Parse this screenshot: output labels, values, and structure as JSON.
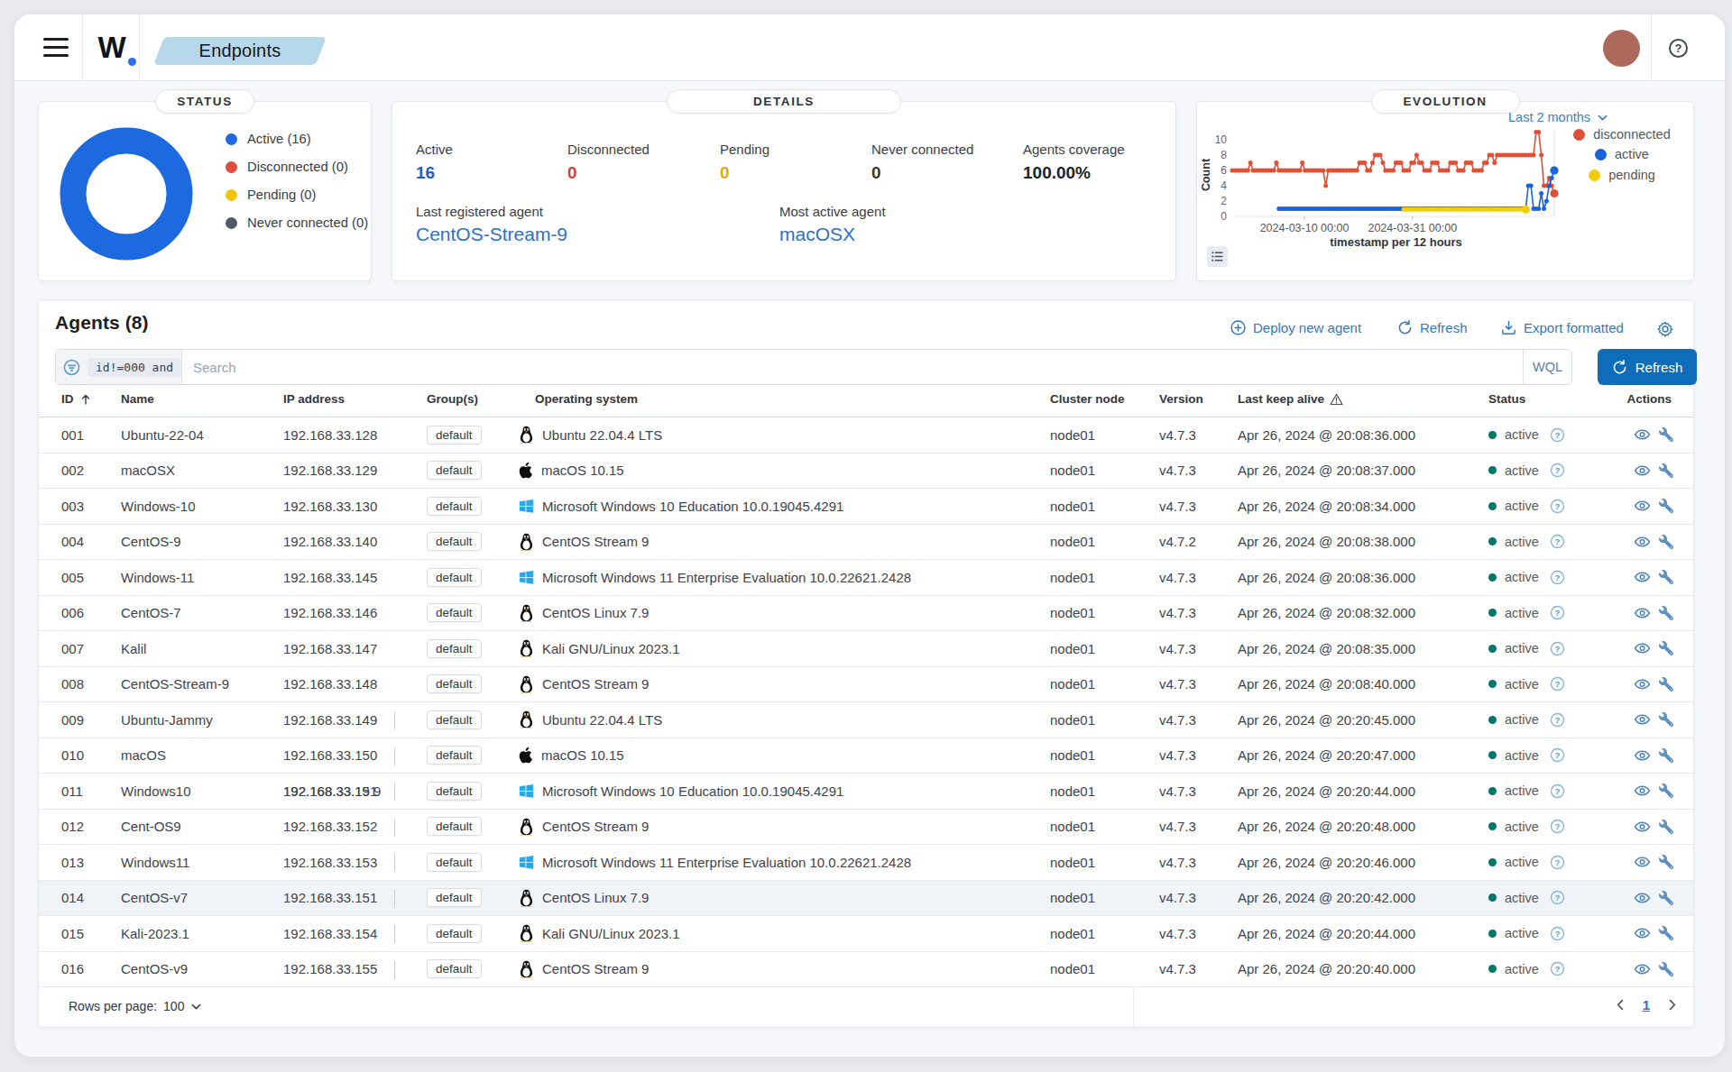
{
  "topbar": {
    "logo_text": "W",
    "logo_dot": ".",
    "breadcrumb": "Endpoints"
  },
  "panels": {
    "status": {
      "title": "STATUS"
    },
    "details": {
      "title": "DETAILS",
      "stats": [
        {
          "label": "Active",
          "value": "16",
          "color": "#1f5ec9"
        },
        {
          "label": "Disconnected",
          "value": "0",
          "color": "#c6493a"
        },
        {
          "label": "Pending",
          "value": "0",
          "color": "#dfa821"
        },
        {
          "label": "Never connected",
          "value": "0",
          "color": "#363940"
        },
        {
          "label": "Agents coverage",
          "value": "100.00%",
          "color": "#20232a"
        }
      ],
      "info": [
        {
          "label": "Last registered agent",
          "value": "CentOS-Stream-9"
        },
        {
          "label": "Most active agent",
          "value": "macOSX"
        }
      ]
    },
    "evolution": {
      "title": "EVOLUTION",
      "range_label": "Last 2 months"
    }
  },
  "chart_data": [
    {
      "id": "agents-status-donut",
      "type": "pie",
      "title": "STATUS",
      "labels": [
        "Active",
        "Disconnected",
        "Pending",
        "Never connected"
      ],
      "values": [
        16,
        0,
        0,
        0
      ],
      "colors": [
        "#1c69e0",
        "#dc4d3b",
        "#f2c40f",
        "#55595f"
      ],
      "donut": true
    },
    {
      "id": "agents-evolution",
      "type": "line",
      "title": "EVOLUTION",
      "xlabel": "timestamp per 12 hours",
      "ylabel": "Count",
      "range_label": "Last 2 months",
      "x_span_days": 62,
      "x_ticks": [
        {
          "label": "2024-03-10 00:00",
          "day": 13.9
        },
        {
          "label": "2024-03-31 00:00",
          "day": 34.7
        }
      ],
      "y_ticks": [
        0,
        2,
        4,
        6,
        8,
        10
      ],
      "ylim": [
        0,
        11.5
      ],
      "legend_position": "right",
      "series": [
        {
          "name": "disconnected",
          "color": "#e05038",
          "points": [
            [
              0,
              6
            ],
            [
              3,
              6
            ],
            [
              3.5,
              7
            ],
            [
              4,
              6
            ],
            [
              8,
              6
            ],
            [
              8.5,
              7
            ],
            [
              9,
              6
            ],
            [
              13,
              6
            ],
            [
              13.5,
              7
            ],
            [
              14,
              6
            ],
            [
              17.5,
              6
            ],
            [
              18,
              4
            ],
            [
              18.5,
              6
            ],
            [
              24,
              6
            ],
            [
              24.5,
              7
            ],
            [
              25.5,
              7
            ],
            [
              26,
              6
            ],
            [
              27,
              7
            ],
            [
              27.5,
              8
            ],
            [
              28.5,
              8
            ],
            [
              29,
              7
            ],
            [
              29.5,
              6
            ],
            [
              31,
              6
            ],
            [
              31.5,
              7
            ],
            [
              32.5,
              7
            ],
            [
              33,
              6
            ],
            [
              34.5,
              7
            ],
            [
              35.5,
              8
            ],
            [
              36,
              7
            ],
            [
              37,
              6
            ],
            [
              38.5,
              7
            ],
            [
              39.5,
              7
            ],
            [
              40,
              6
            ],
            [
              41.5,
              6
            ],
            [
              42,
              7
            ],
            [
              43,
              7
            ],
            [
              43.5,
              6
            ],
            [
              45,
              7
            ],
            [
              46,
              7
            ],
            [
              46.5,
              6
            ],
            [
              48,
              6
            ],
            [
              48.5,
              7
            ],
            [
              49.5,
              8
            ],
            [
              50.5,
              7
            ],
            [
              51,
              8
            ],
            [
              52,
              8
            ],
            [
              58,
              8
            ],
            [
              58.3,
              11
            ],
            [
              58.8,
              11
            ],
            [
              59.2,
              8
            ],
            [
              59.6,
              4
            ],
            [
              60.2,
              4
            ],
            [
              60.6,
              5
            ],
            [
              61.2,
              4
            ],
            [
              61.6,
              3
            ],
            [
              62,
              3
            ]
          ]
        },
        {
          "name": "active",
          "color": "#1a63dd",
          "points": [
            [
              9,
              1
            ],
            [
              56.5,
              1
            ],
            [
              57,
              4
            ],
            [
              57.5,
              4
            ],
            [
              58,
              1
            ],
            [
              59,
              1
            ],
            [
              59.5,
              3
            ],
            [
              60,
              1
            ],
            [
              60.5,
              2
            ],
            [
              61,
              4
            ],
            [
              61.5,
              5
            ],
            [
              62,
              6
            ]
          ]
        },
        {
          "name": "pending",
          "color": "#f2cd0b",
          "points": [
            [
              33,
              0.9
            ],
            [
              56.5,
              0.9
            ]
          ]
        }
      ]
    }
  ],
  "agents": {
    "title": "Agents (8)",
    "actions": [
      {
        "label": "Deploy new agent",
        "icon": "plus-circle"
      },
      {
        "label": "Refresh",
        "icon": "refresh"
      },
      {
        "label": "Export formatted",
        "icon": "download"
      }
    ],
    "search": {
      "filter_token": "id!=000 and",
      "placeholder": "Search",
      "language": "WQL",
      "refresh_label": "Refresh"
    },
    "table": {
      "columns": [
        "ID",
        "Name",
        "IP address",
        "Group(s)",
        "Operating system",
        "Cluster node",
        "Version",
        "Last keep alive",
        "Status",
        "Actions"
      ],
      "rows": [
        {
          "id": "001",
          "name": "Ubuntu-22-04",
          "ip": "192.168.33.128",
          "group": "default",
          "os_icon": "linux",
          "os": "Ubuntu 22.04.4 LTS",
          "node": "node01",
          "version": "v4.7.3",
          "keep_alive": "Apr 26, 2024 @ 20:08:36.000",
          "status": "active"
        },
        {
          "id": "002",
          "name": "macOSX",
          "ip": "192.168.33.129",
          "group": "default",
          "os_icon": "apple",
          "os": "macOS 10.15",
          "node": "node01",
          "version": "v4.7.3",
          "keep_alive": "Apr 26, 2024 @ 20:08:37.000",
          "status": "active"
        },
        {
          "id": "003",
          "name": "Windows-10",
          "ip": "192.168.33.130",
          "group": "default",
          "os_icon": "windows",
          "os": "Microsoft Windows 10 Education 10.0.19045.4291",
          "node": "node01",
          "version": "v4.7.3",
          "keep_alive": "Apr 26, 2024 @ 20:08:34.000",
          "status": "active"
        },
        {
          "id": "004",
          "name": "CentOS-9",
          "ip": "192.168.33.140",
          "group": "default",
          "os_icon": "linux",
          "os": "CentOS Stream 9",
          "node": "node01",
          "version": "v4.7.2",
          "keep_alive": "Apr 26, 2024 @ 20:08:38.000",
          "status": "active"
        },
        {
          "id": "005",
          "name": "Windows-11",
          "ip": "192.168.33.145",
          "group": "default",
          "os_icon": "windows",
          "os": "Microsoft Windows 11 Enterprise Evaluation 10.0.22621.2428",
          "node": "node01",
          "version": "v4.7.3",
          "keep_alive": "Apr 26, 2024 @ 20:08:36.000",
          "status": "active"
        },
        {
          "id": "006",
          "name": "CentOS-7",
          "ip": "192.168.33.146",
          "group": "default",
          "os_icon": "linux",
          "os": "CentOS Linux 7.9",
          "node": "node01",
          "version": "v4.7.3",
          "keep_alive": "Apr 26, 2024 @ 20:08:32.000",
          "status": "active"
        },
        {
          "id": "007",
          "name": "Kalil",
          "ip": "192.168.33.147",
          "group": "default",
          "os_icon": "linux",
          "os": "Kali GNU/Linux 2023.1",
          "node": "node01",
          "version": "v4.7.3",
          "keep_alive": "Apr 26, 2024 @ 20:08:35.000",
          "status": "active"
        },
        {
          "id": "008",
          "name": "CentOS-Stream-9",
          "ip": "192.168.33.148",
          "group": "default",
          "os_icon": "linux",
          "os": "CentOS Stream 9",
          "node": "node01",
          "version": "v4.7.3",
          "keep_alive": "Apr 26, 2024 @ 20:08:40.000",
          "status": "active"
        },
        {
          "id": "009",
          "name": "Ubuntu-Jammy",
          "ip": "192.168.33.149",
          "group": "default",
          "os_icon": "linux",
          "os": "Ubuntu 22.04.4 LTS",
          "node": "node01",
          "version": "v4.7.3",
          "keep_alive": "Apr 26, 2024 @ 20:20:45.000",
          "status": "active",
          "tick": true
        },
        {
          "id": "010",
          "name": "macOS",
          "ip": "192.168.33.150",
          "group": "default",
          "os_icon": "apple",
          "os": "macOS 10.15",
          "node": "node01",
          "version": "v4.7.3",
          "keep_alive": "Apr 26, 2024 @ 20:20:47.000",
          "status": "active",
          "tick": true
        },
        {
          "id": "011",
          "name": "Windows10",
          "ip": "192.168.33.151",
          "ip_ghost": "192.168.33.19 9",
          "group": "default",
          "os_icon": "windows",
          "os": "Microsoft Windows 10 Education 10.0.19045.4291",
          "node": "node01",
          "version": "v4.7.3",
          "keep_alive": "Apr 26, 2024 @ 20:20:44.000",
          "status": "active",
          "tick": true
        },
        {
          "id": "012",
          "name": "Cent-OS9",
          "ip": "192.168.33.152",
          "group": "default",
          "os_icon": "linux",
          "os": "CentOS Stream 9",
          "node": "node01",
          "version": "v4.7.3",
          "keep_alive": "Apr 26, 2024 @ 20:20:48.000",
          "status": "active",
          "tick": true
        },
        {
          "id": "013",
          "name": "Windows11",
          "ip": "192.168.33.153",
          "group": "default",
          "os_icon": "windows",
          "os": "Microsoft Windows 11 Enterprise Evaluation 10.0.22621.2428",
          "node": "node01",
          "version": "v4.7.3",
          "keep_alive": "Apr 26, 2024 @ 20:20:46.000",
          "status": "active",
          "tick": true
        },
        {
          "id": "014",
          "name": "CentOS-v7",
          "ip": "192.168.33.151",
          "group": "default",
          "os_icon": "linux",
          "os": "CentOS Linux 7.9",
          "node": "node01",
          "version": "v4.7.3",
          "keep_alive": "Apr 26, 2024 @ 20:20:42.000",
          "status": "active",
          "highlighted": true,
          "tick": true
        },
        {
          "id": "015",
          "name": "Kali-2023.1",
          "ip": "192.168.33.154",
          "group": "default",
          "os_icon": "linux",
          "os": "Kali GNU/Linux 2023.1",
          "node": "node01",
          "version": "v4.7.3",
          "keep_alive": "Apr 26, 2024 @ 20:20:44.000",
          "status": "active",
          "tick": true
        },
        {
          "id": "016",
          "name": "CentOS-v9",
          "ip": "192.168.33.155",
          "group": "default",
          "os_icon": "linux",
          "os": "CentOS Stream 9",
          "node": "node01",
          "version": "v4.7.3",
          "keep_alive": "Apr 26, 2024 @ 20:20:40.000",
          "status": "active",
          "tick": true
        }
      ]
    },
    "footer": {
      "rows_per_page_label": "Rows per page:",
      "rows_per_page": "100",
      "page": "1"
    }
  }
}
